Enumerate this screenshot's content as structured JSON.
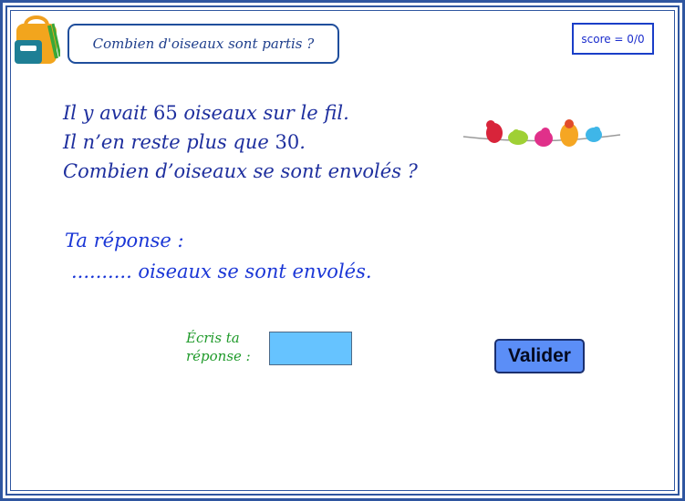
{
  "header": {
    "title": "Combien d'oiseaux sont partis ?",
    "score": "score = 0/0"
  },
  "question": {
    "line1_prefix": "Il y avait ",
    "line1_number": "65",
    "line1_suffix": " oiseaux sur le fil.",
    "line2_prefix": "Il n’en reste plus que ",
    "line2_number": "30",
    "line2_suffix": ".",
    "line3": "Combien d’oiseaux se sont envolés ?"
  },
  "answer": {
    "label": "Ta réponse :",
    "template": ".......... oiseaux se sont envolés."
  },
  "form": {
    "prompt_line1": "Écris ta",
    "prompt_line2": "réponse :",
    "input_value": "",
    "validate_label": "Valider"
  },
  "icons": {
    "backpack": "backpack-icon",
    "birds": "birds-on-wire-image"
  },
  "colors": {
    "frame": "#2f56a0",
    "question_text": "#1e2f9e",
    "answer_text": "#1a36d6",
    "prompt_text": "#1f9a2a",
    "input_bg": "#66c3ff",
    "button_bg": "#5b8ef7"
  }
}
